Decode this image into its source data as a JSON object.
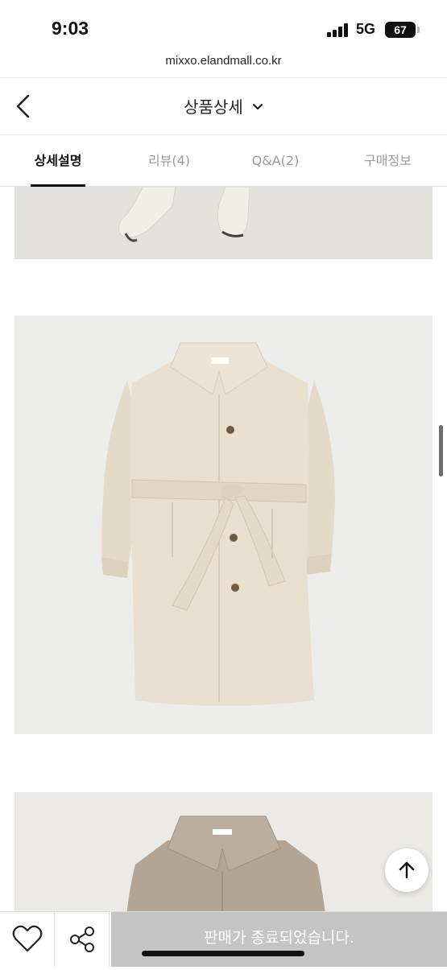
{
  "status_bar": {
    "time": "9:03",
    "network": "5G",
    "battery": "67"
  },
  "browser": {
    "url": "mixxo.elandmall.co.kr"
  },
  "header": {
    "title": "상품상세",
    "back_icon": "chevron-left-icon",
    "dropdown_icon": "chevron-down-icon"
  },
  "tabs": [
    {
      "label": "상세설명",
      "active": true
    },
    {
      "label": "리뷰(4)",
      "active": false
    },
    {
      "label": "Q&A(2)",
      "active": false
    },
    {
      "label": "구매정보",
      "active": false
    }
  ],
  "images": [
    {
      "name": "product-photo-boots"
    },
    {
      "name": "product-photo-beige-coat",
      "colors": {
        "coat": "#e6dccb",
        "background": "#ececea"
      }
    },
    {
      "name": "product-photo-brown-coat",
      "colors": {
        "coat": "#b0a292",
        "background": "#ebeae7"
      }
    }
  ],
  "bottom_bar": {
    "wish_icon": "heart-icon",
    "share_icon": "share-icon",
    "soldout_label": "판매가 종료되었습니다."
  },
  "floating": {
    "scroll_top_icon": "arrow-up-icon"
  }
}
